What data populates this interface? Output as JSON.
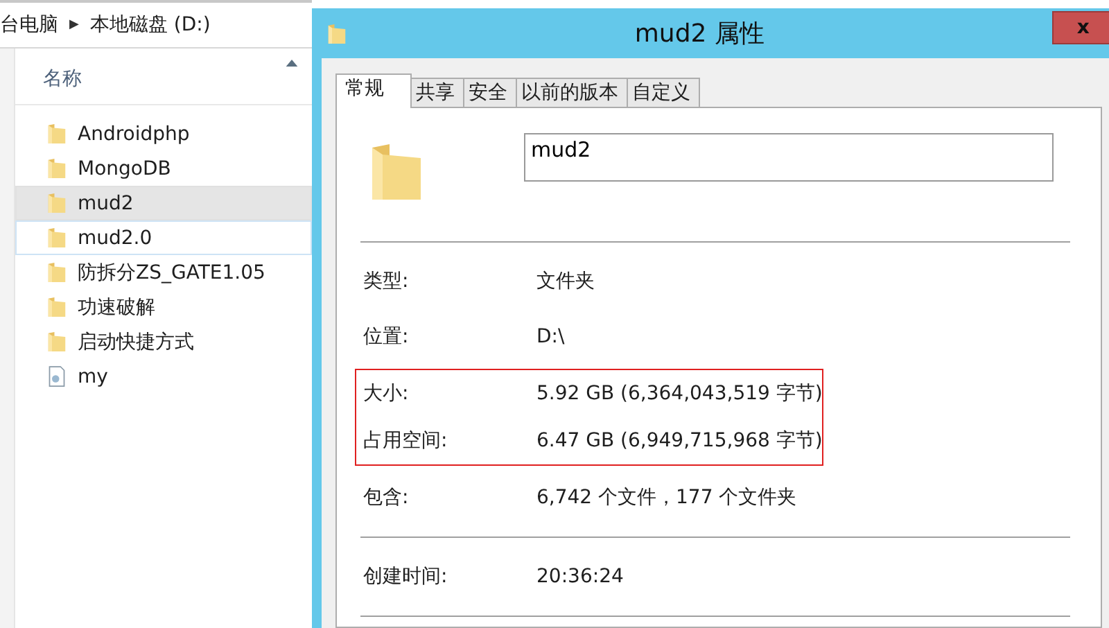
{
  "explorer": {
    "breadcrumb": [
      {
        "label": "台电脑"
      },
      {
        "label": "本地磁盘 (D:)"
      }
    ],
    "separator": "▶",
    "column_header": "名称",
    "items": [
      {
        "name": "Androidphp",
        "kind": "folder",
        "selected": false,
        "focused": false
      },
      {
        "name": "MongoDB",
        "kind": "folder",
        "selected": false,
        "focused": false
      },
      {
        "name": "mud2",
        "kind": "folder",
        "selected": true,
        "focused": false
      },
      {
        "name": "mud2.0",
        "kind": "folder",
        "selected": false,
        "focused": true
      },
      {
        "name": "防拆分ZS_GATE1.05",
        "kind": "folder",
        "selected": false,
        "focused": false
      },
      {
        "name": "功速破解",
        "kind": "folder",
        "selected": false,
        "focused": false
      },
      {
        "name": "启动快捷方式",
        "kind": "folder",
        "selected": false,
        "focused": false
      },
      {
        "name": "my",
        "kind": "file",
        "selected": false,
        "focused": false
      }
    ]
  },
  "dialog": {
    "title": "mud2 属性",
    "close": "x",
    "tabs": [
      {
        "label": "常规",
        "selected": true
      },
      {
        "label": "共享",
        "selected": false
      },
      {
        "label": "安全",
        "selected": false
      },
      {
        "label": "以前的版本",
        "selected": false
      },
      {
        "label": "自定义",
        "selected": false
      }
    ],
    "name_value": "mud2",
    "groups": [
      [
        {
          "label": "类型:",
          "value": "文件夹",
          "highlighted": false
        },
        {
          "label": "位置:",
          "value": "D:\\",
          "highlighted": false
        },
        {
          "label": "大小:",
          "value": "5.92 GB (6,364,043,519 字节)",
          "highlighted": true
        },
        {
          "label": "占用空间:",
          "value": "6.47 GB (6,949,715,968 字节)",
          "highlighted": true
        },
        {
          "label": "包含:",
          "value": "6,742 个文件，177 个文件夹",
          "highlighted": false
        }
      ],
      [
        {
          "label": "创建时间:",
          "value": "20:36:24",
          "highlighted": false
        }
      ]
    ]
  }
}
